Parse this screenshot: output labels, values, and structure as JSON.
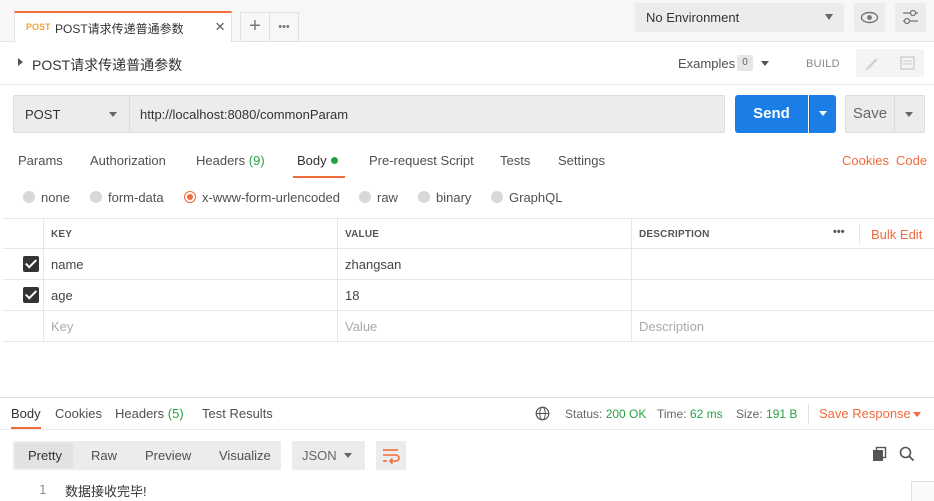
{
  "request_tab": {
    "method": "POST",
    "title": "POST请求传递普通参数"
  },
  "environment": {
    "selected": "No Environment"
  },
  "request": {
    "name": "POST请求传递普通参数",
    "examples_label": "Examples",
    "examples_count": "0",
    "build_label": "BUILD",
    "method": "POST",
    "url": "http://localhost:8080/commonParam",
    "send_label": "Send",
    "save_label": "Save"
  },
  "request_tabs": {
    "params": "Params",
    "authorization": "Authorization",
    "headers": "Headers",
    "headers_count": "(9)",
    "body": "Body",
    "prerequest": "Pre-request Script",
    "tests": "Tests",
    "settings": "Settings",
    "cookies": "Cookies",
    "code": "Code"
  },
  "body_types": {
    "none": "none",
    "form_data": "form-data",
    "urlencoded": "x-www-form-urlencoded",
    "raw": "raw",
    "binary": "binary",
    "graphql": "GraphQL"
  },
  "table": {
    "headers": {
      "key": "KEY",
      "value": "VALUE",
      "description": "DESCRIPTION",
      "bulk_edit": "Bulk Edit"
    },
    "rows": [
      {
        "key": "name",
        "value": "zhangsan",
        "description": ""
      },
      {
        "key": "age",
        "value": "18",
        "description": ""
      }
    ],
    "placeholders": {
      "key": "Key",
      "value": "Value",
      "description": "Description"
    }
  },
  "response": {
    "tabs": {
      "body": "Body",
      "cookies": "Cookies",
      "headers": "Headers",
      "headers_count": "(5)",
      "test_results": "Test Results"
    },
    "status_label": "Status:",
    "status_value": "200 OK",
    "time_label": "Time:",
    "time_value": "62 ms",
    "size_label": "Size:",
    "size_value": "191 B",
    "save_response": "Save Response",
    "formats": {
      "pretty": "Pretty",
      "raw": "Raw",
      "preview": "Preview",
      "visualize": "Visualize"
    },
    "language": "JSON",
    "lines": [
      {
        "num": "1",
        "text": "数据接收完毕!"
      }
    ]
  },
  "colors": {
    "accent": "#f26b3a",
    "send": "#1a7ee6",
    "success": "#26a142"
  }
}
